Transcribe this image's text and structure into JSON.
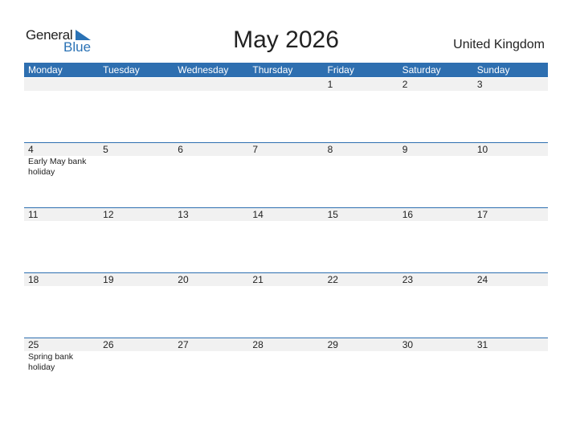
{
  "logo": {
    "general": "General",
    "blue": "Blue",
    "accent_color": "#2a72b5"
  },
  "title": "May 2026",
  "country": "United Kingdom",
  "colors": {
    "header_bg": "#2e6fb0",
    "date_strip_bg": "#f1f1f1"
  },
  "weekdays": [
    "Monday",
    "Tuesday",
    "Wednesday",
    "Thursday",
    "Friday",
    "Saturday",
    "Sunday"
  ],
  "weeks": [
    {
      "days": [
        {
          "date": "",
          "holiday": ""
        },
        {
          "date": "",
          "holiday": ""
        },
        {
          "date": "",
          "holiday": ""
        },
        {
          "date": "",
          "holiday": ""
        },
        {
          "date": "1",
          "holiday": ""
        },
        {
          "date": "2",
          "holiday": ""
        },
        {
          "date": "3",
          "holiday": ""
        }
      ]
    },
    {
      "days": [
        {
          "date": "4",
          "holiday": "Early May bank holiday"
        },
        {
          "date": "5",
          "holiday": ""
        },
        {
          "date": "6",
          "holiday": ""
        },
        {
          "date": "7",
          "holiday": ""
        },
        {
          "date": "8",
          "holiday": ""
        },
        {
          "date": "9",
          "holiday": ""
        },
        {
          "date": "10",
          "holiday": ""
        }
      ]
    },
    {
      "days": [
        {
          "date": "11",
          "holiday": ""
        },
        {
          "date": "12",
          "holiday": ""
        },
        {
          "date": "13",
          "holiday": ""
        },
        {
          "date": "14",
          "holiday": ""
        },
        {
          "date": "15",
          "holiday": ""
        },
        {
          "date": "16",
          "holiday": ""
        },
        {
          "date": "17",
          "holiday": ""
        }
      ]
    },
    {
      "days": [
        {
          "date": "18",
          "holiday": ""
        },
        {
          "date": "19",
          "holiday": ""
        },
        {
          "date": "20",
          "holiday": ""
        },
        {
          "date": "21",
          "holiday": ""
        },
        {
          "date": "22",
          "holiday": ""
        },
        {
          "date": "23",
          "holiday": ""
        },
        {
          "date": "24",
          "holiday": ""
        }
      ]
    },
    {
      "days": [
        {
          "date": "25",
          "holiday": "Spring bank holiday"
        },
        {
          "date": "26",
          "holiday": ""
        },
        {
          "date": "27",
          "holiday": ""
        },
        {
          "date": "28",
          "holiday": ""
        },
        {
          "date": "29",
          "holiday": ""
        },
        {
          "date": "30",
          "holiday": ""
        },
        {
          "date": "31",
          "holiday": ""
        }
      ]
    }
  ]
}
